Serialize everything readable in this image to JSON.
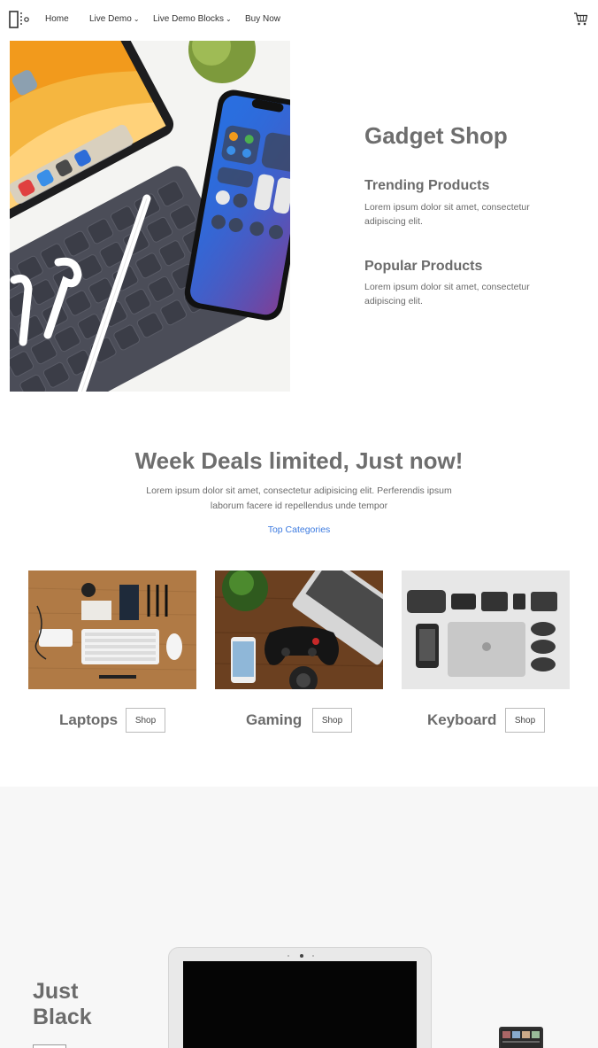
{
  "nav": {
    "items": [
      {
        "label": "Home",
        "has_dropdown": false
      },
      {
        "label": "Live Demo",
        "has_dropdown": true
      },
      {
        "label": "Live Demo Blocks",
        "has_dropdown": true
      },
      {
        "label": "Buy Now",
        "has_dropdown": false
      }
    ],
    "logo_icon": "columns-logo-icon",
    "cart_icon": "cart-icon"
  },
  "hero": {
    "title": "Gadget Shop",
    "features": [
      {
        "title": "Trending Products",
        "text": "Lorem ipsum dolor sit amet, consectetur adipiscing elit."
      },
      {
        "title": "Popular Products",
        "text": "Lorem ipsum dolor sit amet, consectetur adipiscing elit."
      }
    ]
  },
  "deals": {
    "title": "Week Deals limited, Just now!",
    "text": "Lorem ipsum dolor sit amet, consectetur adipisicing elit. Perferendis ipsum laborum facere id repellendus unde tempor",
    "link": "Top Categories",
    "link_color": "#3d7be0",
    "cards": [
      {
        "label": "Laptops",
        "button": "Shop"
      },
      {
        "label": "Gaming",
        "button": "Shop"
      },
      {
        "label": "Keyboard",
        "button": "Shop"
      }
    ]
  },
  "bottom": {
    "title": "Just Black"
  },
  "colors": {
    "heading": "#6e6e6e",
    "text": "#6b6b6b",
    "section_bg": "#f7f7f7"
  }
}
